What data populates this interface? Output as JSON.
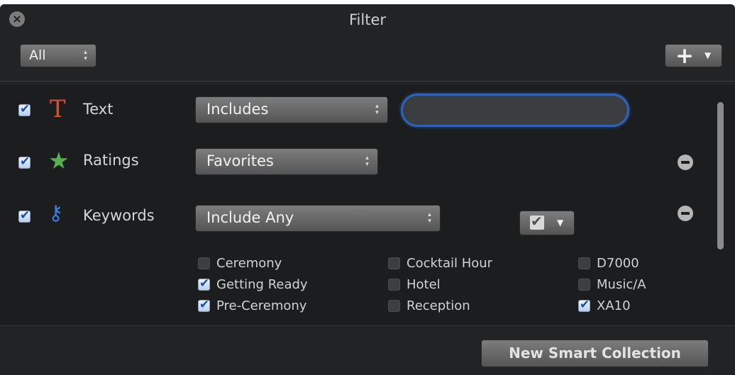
{
  "window": {
    "title": "Filter"
  },
  "toolbar": {
    "scope_value": "All"
  },
  "rows": {
    "text": {
      "label": "Text",
      "operator": "Includes",
      "value": ""
    },
    "ratings": {
      "label": "Ratings",
      "operator": "Favorites"
    },
    "keywords": {
      "label": "Keywords",
      "operator": "Include Any"
    }
  },
  "keyword_options": [
    {
      "label": "Ceremony",
      "checked": false
    },
    {
      "label": "Getting Ready",
      "checked": true
    },
    {
      "label": "Pre-Ceremony",
      "checked": true
    },
    {
      "label": "Cocktail Hour",
      "checked": false
    },
    {
      "label": "Hotel",
      "checked": false
    },
    {
      "label": "Reception",
      "checked": false
    },
    {
      "label": "D7000",
      "checked": false
    },
    {
      "label": "Music/A",
      "checked": false
    },
    {
      "label": "XA10",
      "checked": true
    }
  ],
  "footer": {
    "new_smart_collection_label": "New Smart Collection"
  },
  "colors": {
    "background": "#222325",
    "focus_ring": "#2e62b8",
    "text_icon": "#d9502e",
    "star_icon": "#55b04e",
    "key_icon": "#3d7fdc"
  },
  "icons": [
    "close-icon",
    "text-icon",
    "star-icon",
    "key-icon",
    "plus-icon",
    "minus-icon",
    "checkbox-icon"
  ]
}
